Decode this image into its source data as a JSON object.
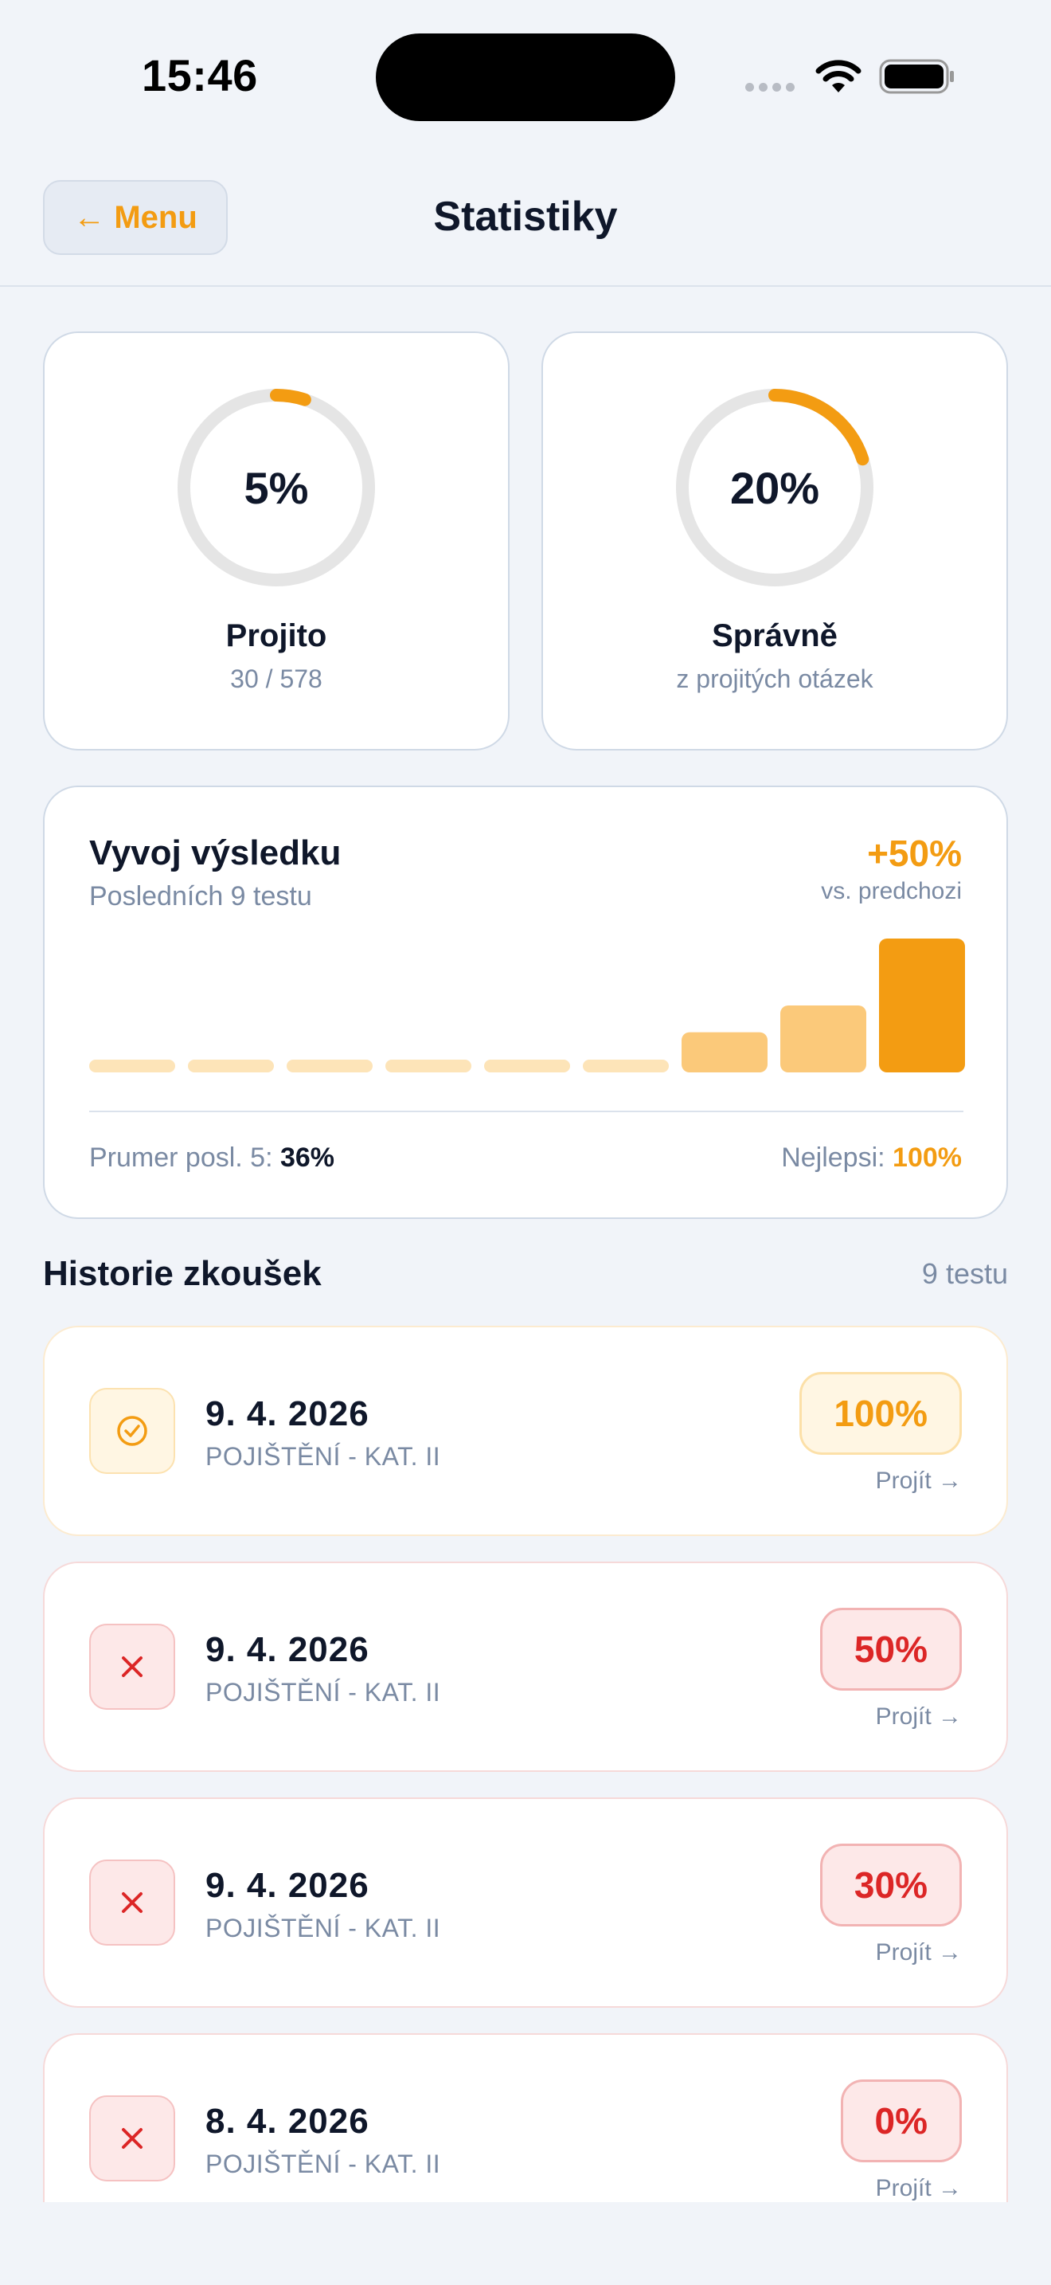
{
  "status_bar": {
    "time": "15:46"
  },
  "header": {
    "back_label": "← Menu",
    "title": "Statistiky"
  },
  "stats": {
    "progress": {
      "value_text": "5%",
      "fraction": 0.05,
      "label": "Projito",
      "sub": "30 / 578"
    },
    "correct": {
      "value_text": "20%",
      "fraction": 0.2,
      "label": "Správně",
      "sub": "z projitých otázek"
    }
  },
  "colors": {
    "accent": "#f39c12",
    "ring_track": "#e5e5e5",
    "fail": "#dc2626"
  },
  "trend": {
    "title": "Vyvoj výsledku",
    "subtitle": "Posledních 9 testu",
    "delta": "+50%",
    "delta_sub": "vs. predchozi",
    "avg_label": "Prumer posl. 5: ",
    "avg_value": "36%",
    "best_label": "Nejlepsi: ",
    "best_value": "100%"
  },
  "chart_data": {
    "type": "bar",
    "values": [
      0,
      0,
      0,
      0,
      0,
      0,
      30,
      50,
      100
    ],
    "ylim": [
      0,
      100
    ]
  },
  "history": {
    "title": "Historie zkoušek",
    "count": "9 testu",
    "items": [
      {
        "date": "9. 4. 2026",
        "category": "POJIŠTĚNÍ - KAT. II",
        "score": "100%",
        "status": "pass",
        "action": "Projít →"
      },
      {
        "date": "9. 4. 2026",
        "category": "POJIŠTĚNÍ - KAT. II",
        "score": "50%",
        "status": "fail",
        "action": "Projít →"
      },
      {
        "date": "9. 4. 2026",
        "category": "POJIŠTĚNÍ - KAT. II",
        "score": "30%",
        "status": "fail",
        "action": "Projít →"
      },
      {
        "date": "8. 4. 2026",
        "category": "POJIŠTĚNÍ - KAT. II",
        "score": "0%",
        "status": "fail",
        "action": "Projít →"
      }
    ]
  }
}
